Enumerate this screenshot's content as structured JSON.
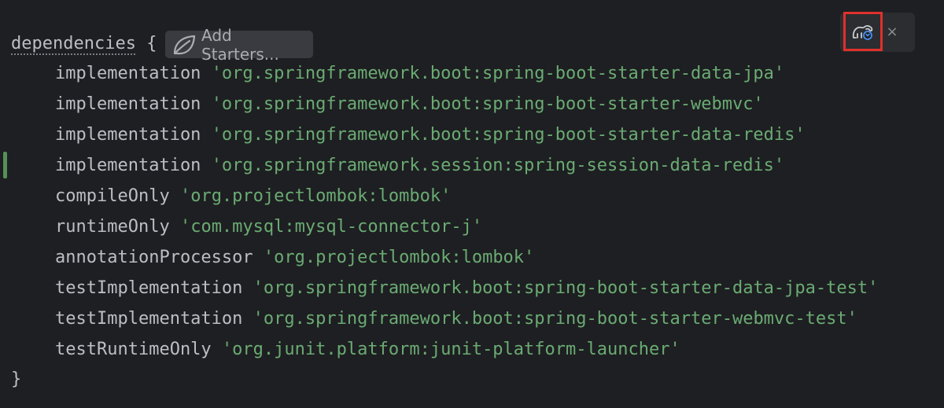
{
  "editor": {
    "open_line": {
      "keyword": "dependencies",
      "brace": "{"
    },
    "add_starters": {
      "label": "Add Starters..."
    },
    "lines": [
      {
        "config": "implementation",
        "artifact": "'org.springframework.boot:spring-boot-starter-data-jpa'"
      },
      {
        "config": "implementation",
        "artifact": "'org.springframework.boot:spring-boot-starter-webmvc'"
      },
      {
        "config": "implementation",
        "artifact": "'org.springframework.boot:spring-boot-starter-data-redis'"
      },
      {
        "config": "implementation",
        "artifact": "'org.springframework.session:spring-session-data-redis'"
      },
      {
        "config": "compileOnly",
        "artifact": "'org.projectlombok:lombok'"
      },
      {
        "config": "runtimeOnly",
        "artifact": "'com.mysql:mysql-connector-j'"
      },
      {
        "config": "annotationProcessor",
        "artifact": "'org.projectlombok:lombok'"
      },
      {
        "config": "testImplementation",
        "artifact": "'org.springframework.boot:spring-boot-starter-data-jpa-test'"
      },
      {
        "config": "testImplementation",
        "artifact": "'org.springframework.boot:spring-boot-starter-webmvc-test'"
      },
      {
        "config": "testRuntimeOnly",
        "artifact": "'org.junit.platform:junit-platform-launcher'"
      }
    ],
    "close_brace": "}"
  },
  "toolbar": {
    "sync_icon": "gradle-sync-icon",
    "close_label": "×"
  },
  "colors": {
    "background": "#1e1f22",
    "text": "#bcbec4",
    "string": "#6aab73",
    "highlight": "#e0302c",
    "gutter_change": "#549159"
  }
}
